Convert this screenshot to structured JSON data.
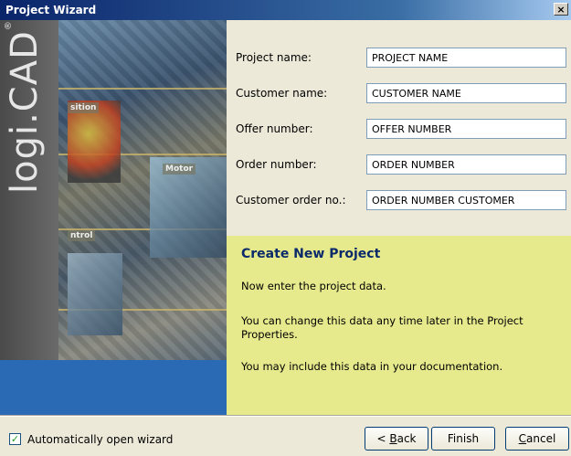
{
  "window": {
    "title": "Project Wizard",
    "close_glyph": "×"
  },
  "sidebar": {
    "logo_text": "logi.CAD",
    "logo_mark": "®",
    "photo_labels": [
      "sition",
      "Motor",
      "ntrol"
    ]
  },
  "form": {
    "fields": [
      {
        "label": "Project name:",
        "value": "PROJECT NAME"
      },
      {
        "label": "Customer name:",
        "value": "CUSTOMER NAME"
      },
      {
        "label": "Offer number:",
        "value": "OFFER NUMBER"
      },
      {
        "label": "Order number:",
        "value": "ORDER NUMBER"
      },
      {
        "label": "Customer order no.:",
        "value": "ORDER NUMBER CUSTOMER"
      }
    ]
  },
  "info": {
    "title": "Create New Project",
    "paragraphs": [
      "Now enter the project data.",
      "You can change this data any time later in the Project Properties.",
      "You may include this data in your documentation."
    ],
    "background": "#e6e98c"
  },
  "footer": {
    "auto_open_label": "Automatically open wizard",
    "auto_open_checked": true,
    "back_prefix": "< ",
    "back_accel": "B",
    "back_rest": "ack",
    "finish_label": "Finish",
    "cancel_accel": "C",
    "cancel_rest": "ancel"
  }
}
